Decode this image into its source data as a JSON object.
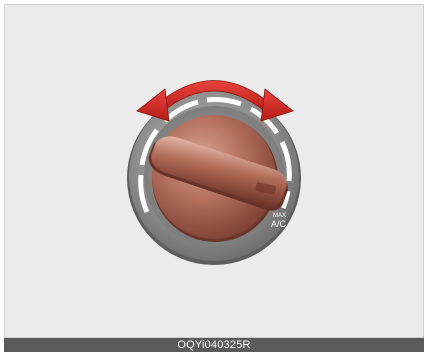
{
  "caption": "OQYi040325R",
  "dial": {
    "label_small": "MAX",
    "label_main": "A/C"
  },
  "colors": {
    "background": "#ebebeb",
    "bezel": "#8a8a8a",
    "knob": "#a9614f",
    "arrow": "#d42a25",
    "caption_bar": "#5a5a5a"
  },
  "icons": {
    "arrow": "double-headed-curved-arrow-icon"
  }
}
